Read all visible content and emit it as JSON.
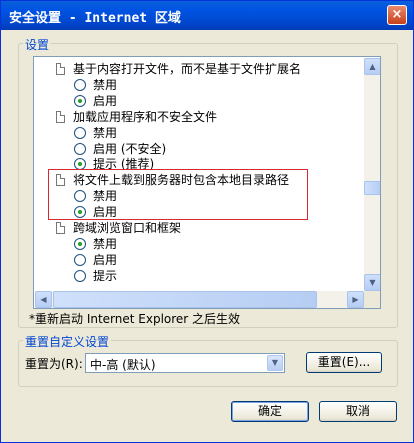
{
  "window": {
    "title": "安全设置 - Internet 区域",
    "close_glyph": "×"
  },
  "settings_group": {
    "label": "设置",
    "items": [
      {
        "type": "header",
        "label": "基于内容打开文件，而不是基于文件扩展名"
      },
      {
        "type": "option",
        "label": "禁用",
        "selected": false
      },
      {
        "type": "option",
        "label": "启用",
        "selected": true
      },
      {
        "type": "header",
        "label": "加载应用程序和不安全文件"
      },
      {
        "type": "option",
        "label": "禁用",
        "selected": false
      },
      {
        "type": "option",
        "label": "启用 (不安全)",
        "selected": false
      },
      {
        "type": "option",
        "label": "提示 (推荐)",
        "selected": true
      },
      {
        "type": "header",
        "label": "将文件上载到服务器时包含本地目录路径"
      },
      {
        "type": "option",
        "label": "禁用",
        "selected": false
      },
      {
        "type": "option",
        "label": "启用",
        "selected": true
      },
      {
        "type": "header",
        "label": "跨域浏览窗口和框架"
      },
      {
        "type": "option",
        "label": "禁用",
        "selected": true
      },
      {
        "type": "option",
        "label": "启用",
        "selected": false
      },
      {
        "type": "option",
        "label": "提示",
        "selected": false
      }
    ],
    "note": "*重新启动 Internet Explorer 之后生效"
  },
  "reset_group": {
    "label": "重置自定义设置",
    "reset_to_label": "重置为(R):",
    "level_value": "中-高 (默认)",
    "reset_button": "重置(E)..."
  },
  "buttons": {
    "ok": "确定",
    "cancel": "取消"
  },
  "icons": {
    "scroll_up": "▲",
    "scroll_down": "▼",
    "scroll_left": "◀",
    "scroll_right": "▶",
    "dropdown": "▼"
  }
}
